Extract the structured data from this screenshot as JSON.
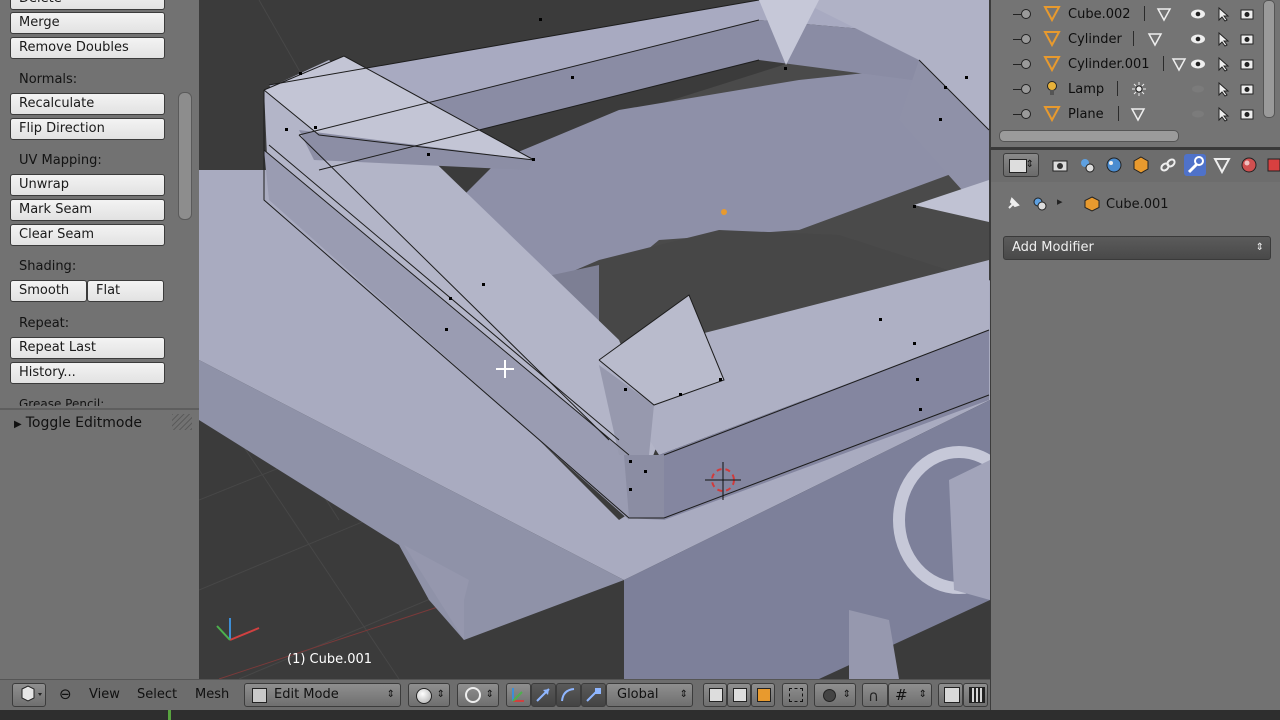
{
  "toolshelf": {
    "top_cut_button": "Delete",
    "merge": "Merge",
    "remove_doubles": "Remove Doubles",
    "normals_label": "Normals:",
    "recalculate": "Recalculate",
    "flip_direction": "Flip Direction",
    "uv_label": "UV Mapping:",
    "unwrap": "Unwrap",
    "mark_seam": "Mark Seam",
    "clear_seam": "Clear Seam",
    "shading_label": "Shading:",
    "smooth": "Smooth",
    "flat": "Flat",
    "repeat_label": "Repeat:",
    "repeat_last": "Repeat Last",
    "history": "History...",
    "grease_pencil": "Grease Pencil:",
    "toggle_editmode": "Toggle Editmode"
  },
  "viewport": {
    "object_label": "(1) Cube.001"
  },
  "header": {
    "menu_view": "View",
    "menu_select": "Select",
    "menu_mesh": "Mesh",
    "mode": "Edit Mode",
    "orientation": "Global"
  },
  "outliner": {
    "items": [
      {
        "name": "Cube.002",
        "icon": "mesh-object-icon"
      },
      {
        "name": "Cylinder",
        "icon": "mesh-object-icon"
      },
      {
        "name": "Cylinder.001",
        "icon": "mesh-object-icon"
      },
      {
        "name": "Lamp",
        "icon": "lamp-icon"
      },
      {
        "name": "Plane",
        "icon": "mesh-object-icon"
      }
    ]
  },
  "properties": {
    "context_object": "Cube.001",
    "add_modifier": "Add Modifier",
    "active_tab": "modifiers"
  },
  "colors": {
    "active_tab": "#4f72c9",
    "object_orange": "#e89a2e",
    "mesh_face": "#a7a9c2"
  }
}
